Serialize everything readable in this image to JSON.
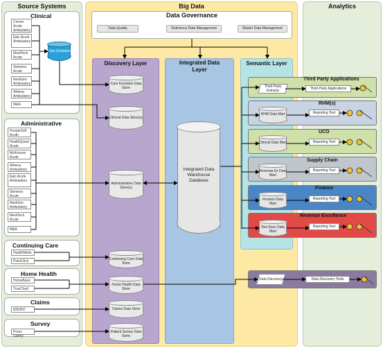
{
  "columns": {
    "source": "Source Systems",
    "bigdata": "Big Data",
    "analytics": "Analytics"
  },
  "clinical": {
    "title": "Clinical",
    "items": [
      "Cerner Acute Ambulatory",
      "Epic Acute Ambulatory",
      "MediTech Acute",
      "Siemens Acute",
      "NextGen Ambulatory",
      "Athena Ambulatory",
      "M&A"
    ],
    "care_evolution": "Care Evolution"
  },
  "administrative": {
    "title": "Administrative",
    "items": [
      "PeopleSoft Acute",
      "HealthQuest Acute",
      "McKesson Acute",
      "Athena Ambulatory",
      "Epic Acute Ambulatory",
      "Siemens Acute",
      "NextGen Ambulatory",
      "MediTech Acute",
      "M&A"
    ]
  },
  "continuing_care": {
    "title": "Continuing Care",
    "items": [
      "HealthMeds",
      "PointClick"
    ]
  },
  "home_health": {
    "title": "Home Health",
    "items": [
      "HomeBase",
      "TrueChart"
    ]
  },
  "claims": {
    "title": "Claims",
    "items": [
      "835/837"
    ]
  },
  "survey": {
    "title": "Survey",
    "items": [
      "Press Ganey"
    ]
  },
  "governance": {
    "title": "Data Governance",
    "items": [
      "Data Quality",
      "Reference Data Management",
      "Master Data Management"
    ]
  },
  "discovery": {
    "title": "Discovery Layer",
    "stores": [
      "Care Evolution Data Store",
      "Clinical Data Store(s)",
      "Administrative Data Store(s)",
      "Continuing Care Data Store",
      "Home Health Data Store",
      "Claims Data Store",
      "Patient Survey Data Store"
    ]
  },
  "integrated": {
    "title": "Integrated Data Layer",
    "warehouse": "Integrated Data Warehouse Database"
  },
  "semantic": {
    "title": "Semantic Layer"
  },
  "analytics_bands": [
    {
      "title": "Third Party Applications",
      "source": "Third Party Extracts",
      "target": "Third Party Applications",
      "color": "#cfe0a8"
    },
    {
      "title": "RHM(s)",
      "source": "RHM Data Mart",
      "target": "Reporting Tool",
      "color": "#c8d3e3"
    },
    {
      "title": "UCO",
      "source": "Clinical Data Mart",
      "target": "Reporting Tool",
      "color": "#cfe0a8"
    },
    {
      "title": "Supply Chain",
      "source": "Revenue Ex Data Mart",
      "target": "Reporting Tool",
      "color": "#bfc7cc"
    },
    {
      "title": "Finance",
      "source": "Finance Data Mart",
      "target": "Reporting Tool",
      "color": "#4a86c5"
    },
    {
      "title": "Revenue Excellence",
      "source": "Rev Exec Data Mart",
      "target": "Reporting Tool",
      "color": "#e24a48"
    }
  ],
  "discovery_tools": {
    "source": "Data Discovery",
    "target": "Data Discovery Tools"
  }
}
